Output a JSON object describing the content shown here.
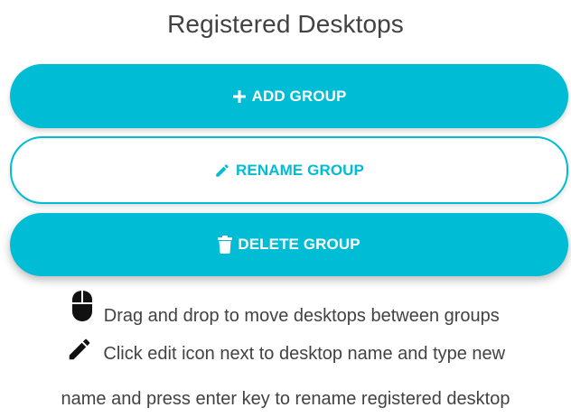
{
  "page": {
    "title": "Registered Desktops"
  },
  "buttons": {
    "add": {
      "label": "ADD GROUP",
      "icon": "plus-icon"
    },
    "rename": {
      "label": "RENAME GROUP",
      "icon": "pencil-icon"
    },
    "delete": {
      "label": "DELETE GROUP",
      "icon": "trash-icon"
    }
  },
  "hints": {
    "drag": {
      "icon": "mouse-icon",
      "text": "Drag and drop to move desktops between groups"
    },
    "edit": {
      "icon": "pencil-icon",
      "line1": "Click edit icon next to desktop name and type new",
      "line2": "name and press enter key to rename registered desktop"
    }
  },
  "colors": {
    "accent": "#00bcd4",
    "text": "#424242",
    "background": "#ffffff"
  }
}
